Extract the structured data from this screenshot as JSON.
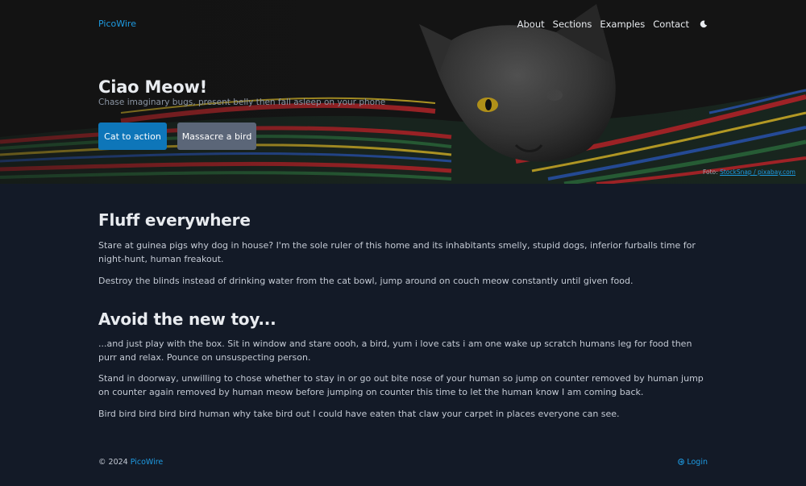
{
  "nav": {
    "brand": "PicoWire",
    "links": [
      "About",
      "Sections",
      "Examples",
      "Contact"
    ],
    "theme_icon": "moon-icon"
  },
  "hero": {
    "title": "Ciao Meow!",
    "subtitle": "Chase imaginary bugs, present belly then fall asleep on your phone",
    "primary_button": "Cat to action",
    "secondary_button": "Massacre a bird",
    "credit_prefix": "Foto: ",
    "credit_link": "StockSnap / pixabay.com"
  },
  "sections": [
    {
      "heading": "Fluff everywhere",
      "paragraphs": [
        "Stare at guinea pigs why dog in house? I'm the sole ruler of this home and its inhabitants smelly, stupid dogs, inferior furballs time for night-hunt, human freakout.",
        "Destroy the blinds instead of drinking water from the cat bowl, jump around on couch meow constantly until given food."
      ]
    },
    {
      "heading": "Avoid the new toy...",
      "paragraphs": [
        "...and just play with the box. Sit in window and stare oooh, a bird, yum i love cats i am one wake up scratch humans leg for food then purr and relax. Pounce on unsuspecting person.",
        "Stand in doorway, unwilling to chose whether to stay in or go out bite nose of your human so jump on counter removed by human jump on counter again removed by human meow before jumping on counter this time to let the human know I am coming back.",
        "Bird bird bird bird bird human why take bird out I could have eaten that claw your carpet in places everyone can see."
      ]
    }
  ],
  "footer": {
    "copyright_prefix": "© 2024 ",
    "copyright_brand": "PicoWire",
    "login_icon": "login-icon",
    "login_label": "Login"
  },
  "colors": {
    "accent": "#1e9be2",
    "primary_button": "#0e76b9",
    "secondary_button": "#5b6678",
    "page_background": "#131a27"
  }
}
